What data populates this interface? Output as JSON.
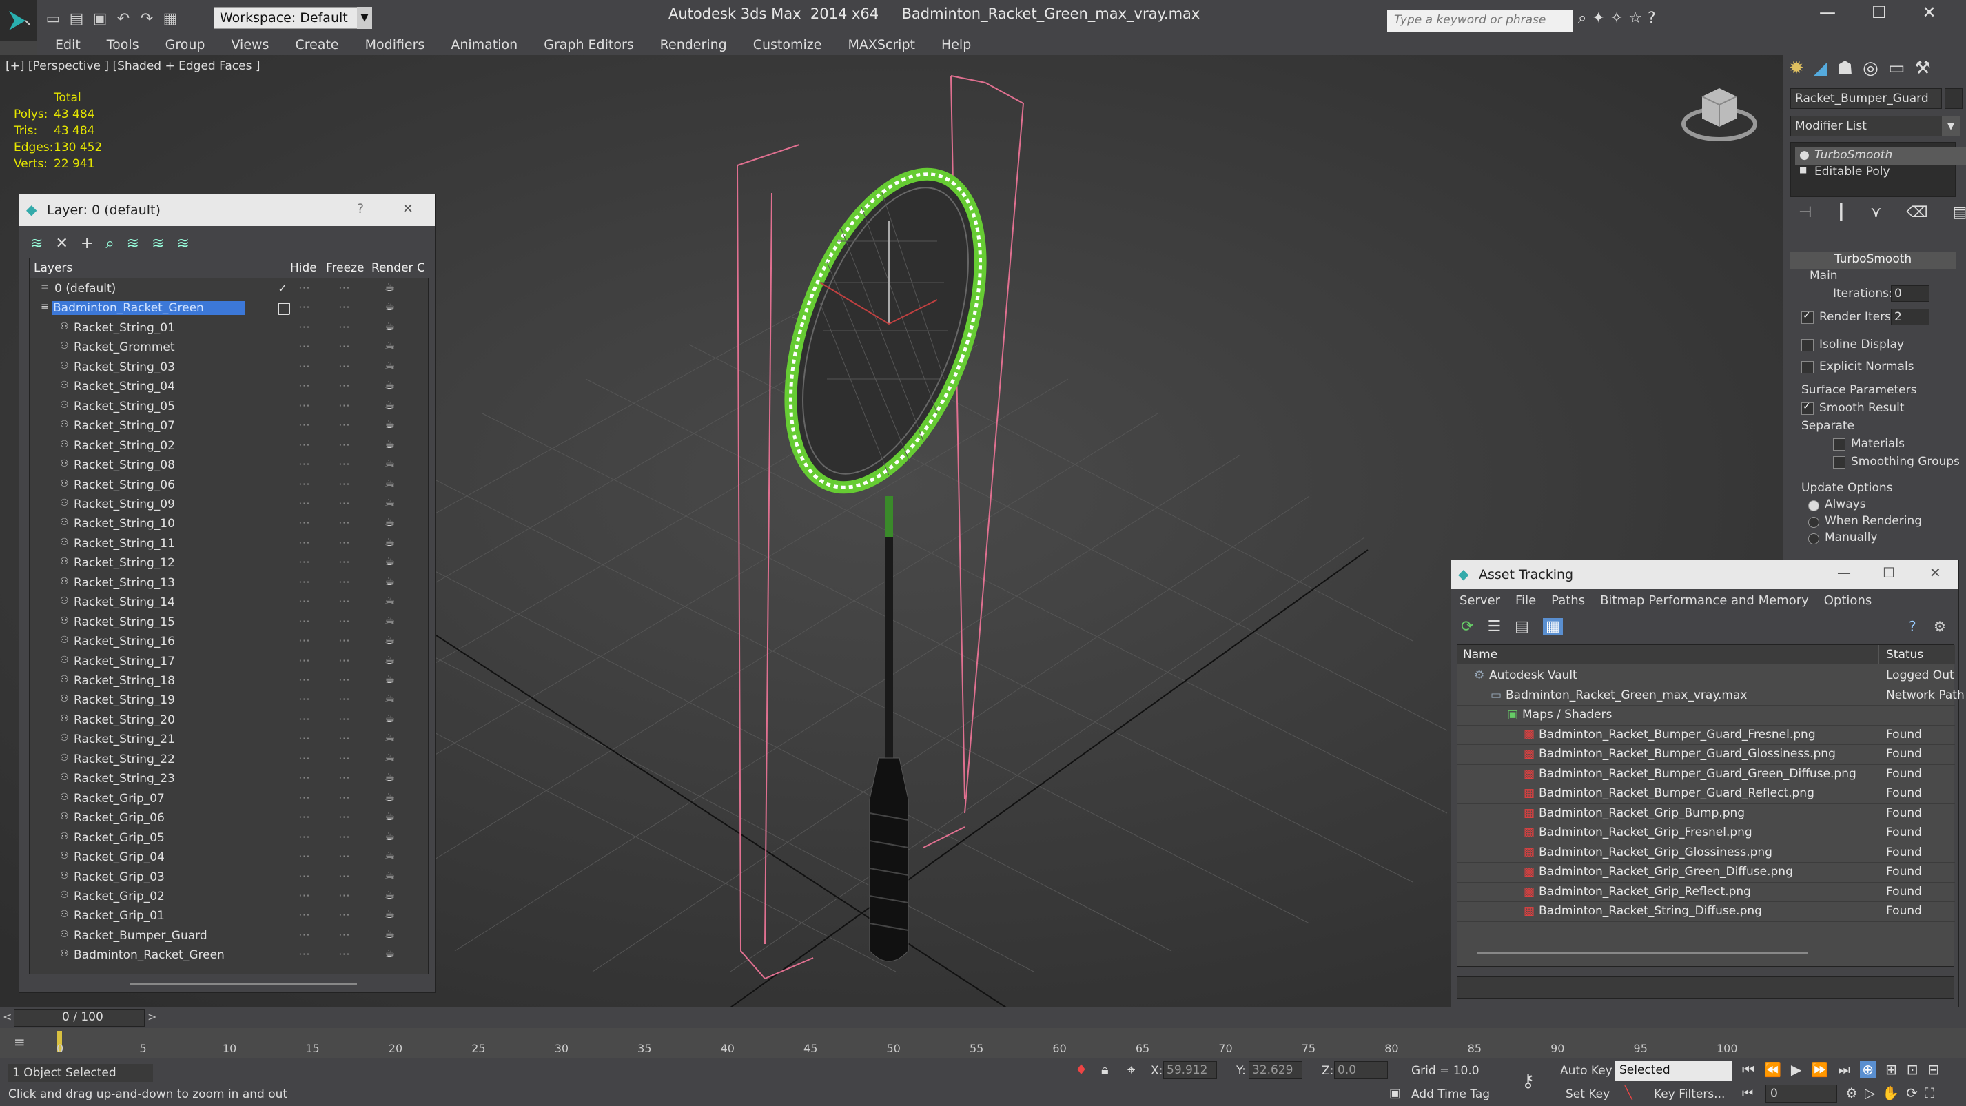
{
  "app": {
    "title": "Autodesk 3ds Max  2014 x64     Badminton_Racket_Green_max_vray.max",
    "workspace": "Workspace: Default",
    "search_placeholder": "Type a keyword or phrase"
  },
  "menu": [
    "Edit",
    "Tools",
    "Group",
    "Views",
    "Create",
    "Modifiers",
    "Animation",
    "Graph Editors",
    "Rendering",
    "Customize",
    "MAXScript",
    "Help"
  ],
  "viewport": {
    "label": "[+] [Perspective ] [Shaded + Edged Faces ]",
    "stats": {
      "header": "Total",
      "rows": [
        {
          "k": "Polys:",
          "v": "43 484"
        },
        {
          "k": "Tris:",
          "v": "43 484"
        },
        {
          "k": "Edges:",
          "v": "130 452"
        },
        {
          "k": "Verts:",
          "v": "22 941"
        }
      ]
    }
  },
  "layer_dialog": {
    "title": "Layer: 0 (default)",
    "help": "?",
    "close": "✕",
    "columns": [
      "Layers",
      "Hide",
      "Freeze",
      "Render",
      "C"
    ],
    "layers": [
      {
        "name": "0 (default)",
        "level": 0,
        "check": "✓"
      },
      {
        "name": "Badminton_Racket_Green",
        "level": 0,
        "selected": true
      },
      {
        "name": "Racket_String_01",
        "level": 1
      },
      {
        "name": "Racket_Grommet",
        "level": 1
      },
      {
        "name": "Racket_String_03",
        "level": 1
      },
      {
        "name": "Racket_String_04",
        "level": 1
      },
      {
        "name": "Racket_String_05",
        "level": 1
      },
      {
        "name": "Racket_String_07",
        "level": 1
      },
      {
        "name": "Racket_String_02",
        "level": 1
      },
      {
        "name": "Racket_String_08",
        "level": 1
      },
      {
        "name": "Racket_String_06",
        "level": 1
      },
      {
        "name": "Racket_String_09",
        "level": 1
      },
      {
        "name": "Racket_String_10",
        "level": 1
      },
      {
        "name": "Racket_String_11",
        "level": 1
      },
      {
        "name": "Racket_String_12",
        "level": 1
      },
      {
        "name": "Racket_String_13",
        "level": 1
      },
      {
        "name": "Racket_String_14",
        "level": 1
      },
      {
        "name": "Racket_String_15",
        "level": 1
      },
      {
        "name": "Racket_String_16",
        "level": 1
      },
      {
        "name": "Racket_String_17",
        "level": 1
      },
      {
        "name": "Racket_String_18",
        "level": 1
      },
      {
        "name": "Racket_String_19",
        "level": 1
      },
      {
        "name": "Racket_String_20",
        "level": 1
      },
      {
        "name": "Racket_String_21",
        "level": 1
      },
      {
        "name": "Racket_String_22",
        "level": 1
      },
      {
        "name": "Racket_String_23",
        "level": 1
      },
      {
        "name": "Racket_Grip_07",
        "level": 1
      },
      {
        "name": "Racket_Grip_06",
        "level": 1
      },
      {
        "name": "Racket_Grip_05",
        "level": 1
      },
      {
        "name": "Racket_Grip_04",
        "level": 1
      },
      {
        "name": "Racket_Grip_03",
        "level": 1
      },
      {
        "name": "Racket_Grip_02",
        "level": 1
      },
      {
        "name": "Racket_Grip_01",
        "level": 1
      },
      {
        "name": "Racket_Bumper_Guard",
        "level": 1
      },
      {
        "name": "Badminton_Racket_Green",
        "level": 1
      }
    ]
  },
  "command_panel": {
    "object_name": "Racket_Bumper_Guard",
    "modifier_list": "Modifier List",
    "stack": [
      "TurboSmooth",
      "Editable Poly"
    ],
    "turbosmooth": {
      "header": "TurboSmooth",
      "main": "Main",
      "iterations_label": "Iterations:",
      "iterations": "0",
      "render_iters_label": "Render Iters:",
      "render_iters": "2",
      "isoline": "Isoline Display",
      "explicit_normals": "Explicit Normals",
      "surface_params": "Surface Parameters",
      "smooth_result": "Smooth Result",
      "separate": "Separate",
      "materials": "Materials",
      "smoothing_groups": "Smoothing Groups",
      "update_options": "Update Options",
      "always": "Always",
      "when_rendering": "When Rendering",
      "manually": "Manually"
    }
  },
  "asset_tracking": {
    "title": "Asset Tracking",
    "menu": [
      "Server",
      "File",
      "Paths",
      "Bitmap Performance and Memory",
      "Options"
    ],
    "columns": [
      "Name",
      "Status"
    ],
    "rows": [
      {
        "name": "Autodesk Vault",
        "status": "Logged Out",
        "level": 0
      },
      {
        "name": "Badminton_Racket_Green_max_vray.max",
        "status": "Network Path",
        "level": 1
      },
      {
        "name": "Maps / Shaders",
        "status": "",
        "level": 2
      },
      {
        "name": "Badminton_Racket_Bumper_Guard_Fresnel.png",
        "status": "Found",
        "level": 3
      },
      {
        "name": "Badminton_Racket_Bumper_Guard_Glossiness.png",
        "status": "Found",
        "level": 3
      },
      {
        "name": "Badminton_Racket_Bumper_Guard_Green_Diffuse.png",
        "status": "Found",
        "level": 3
      },
      {
        "name": "Badminton_Racket_Bumper_Guard_Reflect.png",
        "status": "Found",
        "level": 3
      },
      {
        "name": "Badminton_Racket_Grip_Bump.png",
        "status": "Found",
        "level": 3
      },
      {
        "name": "Badminton_Racket_Grip_Fresnel.png",
        "status": "Found",
        "level": 3
      },
      {
        "name": "Badminton_Racket_Grip_Glossiness.png",
        "status": "Found",
        "level": 3
      },
      {
        "name": "Badminton_Racket_Grip_Green_Diffuse.png",
        "status": "Found",
        "level": 3
      },
      {
        "name": "Badminton_Racket_Grip_Reflect.png",
        "status": "Found",
        "level": 3
      },
      {
        "name": "Badminton_Racket_String_Diffuse.png",
        "status": "Found",
        "level": 3
      }
    ]
  },
  "timeline": {
    "counter": "0 / 100",
    "ticks": [
      "0",
      "5",
      "10",
      "15",
      "20",
      "25",
      "30",
      "35",
      "40",
      "45",
      "50",
      "55",
      "60",
      "65",
      "70",
      "75",
      "80",
      "85",
      "90",
      "95",
      "100"
    ]
  },
  "status": {
    "selection": "1 Object Selected",
    "prompt": "Click and drag up-and-down to zoom in and out",
    "x_label": "X:",
    "x": "59.912",
    "y_label": "Y:",
    "y": "32.629",
    "z_label": "Z:",
    "z": "0.0",
    "grid": "Grid = 10.0",
    "add_time_tag": "Add Time Tag",
    "auto_key": "Auto Key",
    "set_key": "Set Key",
    "selected": "Selected",
    "key_filters": "Key Filters...",
    "frame": "0"
  }
}
